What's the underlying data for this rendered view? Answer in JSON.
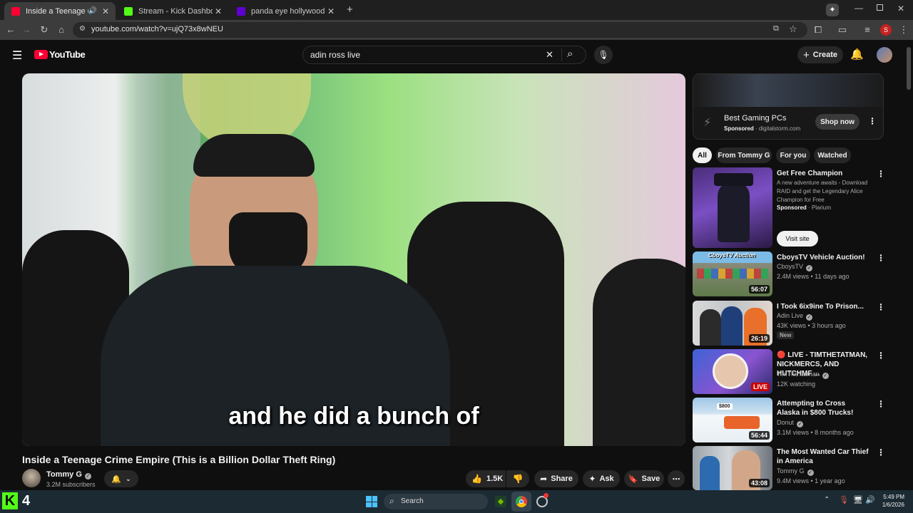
{
  "browser": {
    "tabs": [
      {
        "title": "Inside a Teenage Crime Empi",
        "favicon_color": "#ff0033",
        "active": true
      },
      {
        "title": "Stream - Kick Dashboard",
        "favicon_color": "#53fc18",
        "active": false
      },
      {
        "title": "panda eye hollywood - - Image",
        "favicon_color": "#6001d2",
        "active": false
      }
    ],
    "new_tab": "+",
    "url": "youtube.com/watch?v=ujQ73x8wNEU",
    "profile_initial": "S"
  },
  "youtube": {
    "logo_text": "YouTube",
    "search_query": "adin ross live",
    "create_label": "Create",
    "video": {
      "caption": "and he did a bunch of",
      "title": "Inside a Teenage Crime Empire (This is a Billion Dollar Theft Ring)",
      "channel": "Tommy G",
      "subscribers": "3.2M subscribers",
      "likes": "1.5K",
      "share_label": "Share",
      "ask_label": "Ask",
      "save_label": "Save"
    },
    "ad": {
      "title": "Best Gaming PCs",
      "sponsored": "Sponsored",
      "domain": "· digitalstorm.com",
      "cta": "Shop now"
    },
    "chips": [
      "All",
      "From Tommy G",
      "For you",
      "Watched"
    ],
    "sponsored_rec": {
      "title": "Get Free Champion",
      "desc": "A new adventure awaits - Download RAID and get the Legendary Alice Champion for Free",
      "sponsored": "Sponsored",
      "advertiser": "· Plarium",
      "cta": "Visit site"
    },
    "recommendations": [
      {
        "title": "CboysTV Vehicle Auction!",
        "channel": "CboysTV",
        "meta": "2.4M views • 11 days ago",
        "duration": "56:07",
        "badge": "",
        "thumb_label": "CboysTV Auction"
      },
      {
        "title": "I Took 6ix9ine To Prison...",
        "channel": "Adin Live",
        "meta": "43K views • 3 hours ago",
        "duration": "26:19",
        "badge": "New",
        "thumb_label": ""
      },
      {
        "title": "🔴 LIVE - TIMTHETATMAN, NICKMERCS, AND HUTCHMF ...",
        "channel": "TimTheTatman",
        "meta": "12K watching",
        "duration": "LIVE",
        "badge": "",
        "thumb_label": ""
      },
      {
        "title": "Attempting to Cross Alaska in $800 Trucks!",
        "channel": "Donut",
        "meta": "3.1M views • 8 months ago",
        "duration": "56:44",
        "badge": "",
        "thumb_label": "$800"
      },
      {
        "title": "The Most Wanted Car Thief in America",
        "channel": "Tommy G",
        "meta": "9.4M views • 1 year ago",
        "duration": "43:08",
        "badge": "",
        "thumb_label": ""
      }
    ]
  },
  "taskbar": {
    "kick_count": "4",
    "search_label": "Search",
    "time": "5:49 PM",
    "date": "1/6/2026"
  }
}
